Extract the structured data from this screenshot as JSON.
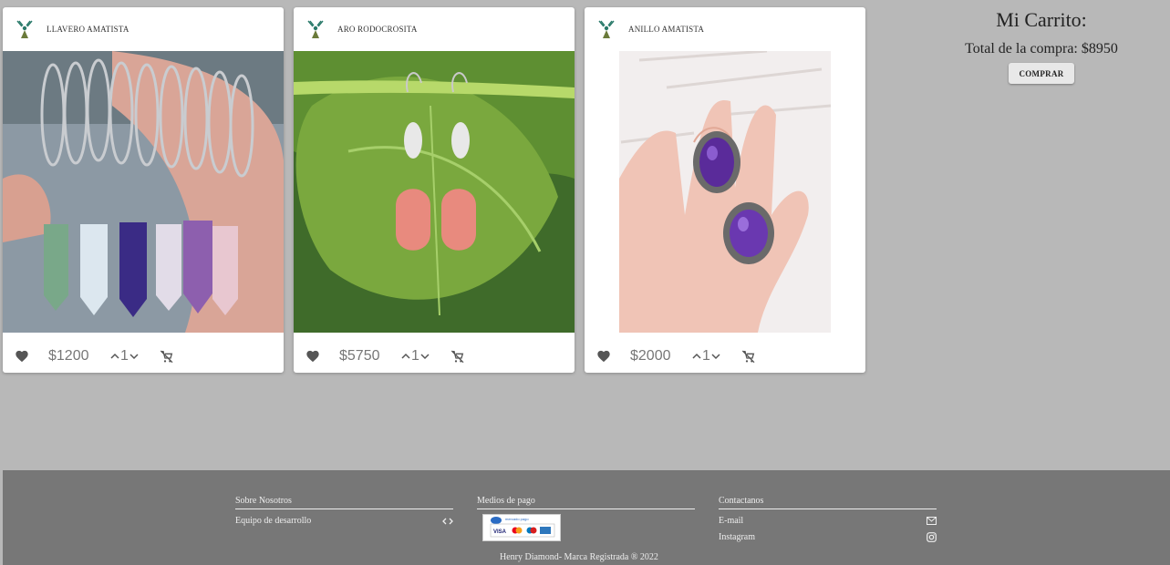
{
  "products": [
    {
      "title": "LLAVERO AMATISTA",
      "price": "$1200",
      "qty": "1"
    },
    {
      "title": "ARO RODOCROSITA",
      "price": "$5750",
      "qty": "1"
    },
    {
      "title": "ANILLO AMATISTA",
      "price": "$2000",
      "qty": "1"
    }
  ],
  "cart": {
    "title": "Mi Carrito:",
    "total": "Total de la compra: $8950",
    "buy_label": "COMPRAR"
  },
  "footer": {
    "about": {
      "heading": "Sobre Nosotros",
      "team_label": "Equipo de desarrollo"
    },
    "payments": {
      "heading": "Medios de pago",
      "logo_text": "mercado pago",
      "cards": [
        "VISA",
        "MC",
        "DC",
        "AMEX"
      ]
    },
    "contact": {
      "heading": "Contactanos",
      "email_label": "E-mail",
      "instagram_label": "Instagram"
    },
    "copyright": "Henry Diamond- Marca Registrada ® 2022"
  },
  "colors": {
    "background": "#b8b8b8",
    "footer": "#777777",
    "icon": "#555555"
  }
}
